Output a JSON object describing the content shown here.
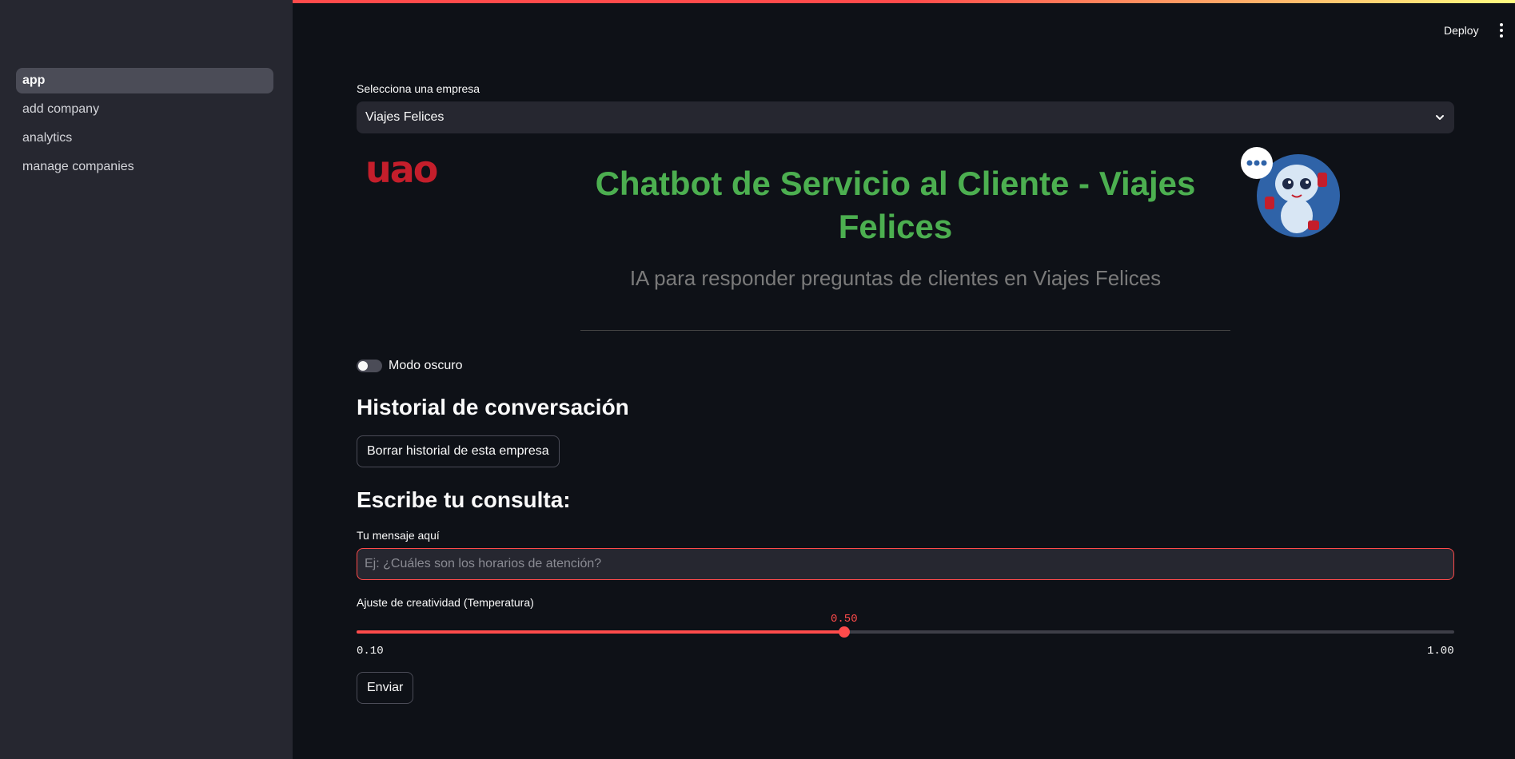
{
  "sidebar": {
    "items": [
      {
        "label": "app",
        "active": true
      },
      {
        "label": "add company",
        "active": false
      },
      {
        "label": "analytics",
        "active": false
      },
      {
        "label": "manage companies",
        "active": false
      }
    ]
  },
  "header": {
    "deploy_label": "Deploy",
    "menu_icon": "vertical-dots-icon"
  },
  "company_select": {
    "label": "Selecciona una empresa",
    "value": "Viajes Felices"
  },
  "banner": {
    "logo_text": "uao",
    "title": "Chatbot de Servicio al Cliente - Viajes Felices",
    "subtitle": "IA para responder preguntas de clientes en Viajes Felices",
    "title_color": "#4caf50"
  },
  "dark_mode": {
    "label": "Modo oscuro",
    "enabled": false
  },
  "history": {
    "heading": "Historial de conversación",
    "clear_button": "Borrar historial de esta empresa"
  },
  "query": {
    "heading": "Escribe tu consulta:",
    "input_label": "Tu mensaje aquí",
    "input_value": "",
    "input_placeholder": "Ej: ¿Cuáles son los horarios de atención?"
  },
  "temperature": {
    "label": "Ajuste de creatividad (Temperatura)",
    "value": "0.50",
    "min": "0.10",
    "max": "1.00",
    "accent": "#ff4b4b"
  },
  "send_button": "Enviar"
}
